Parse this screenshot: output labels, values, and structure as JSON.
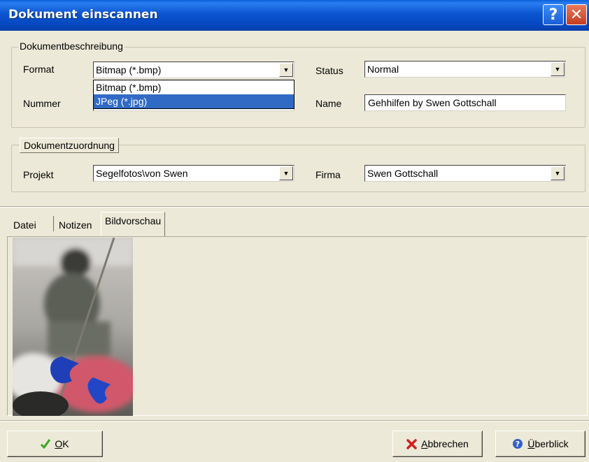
{
  "window": {
    "title": "Dokument einscannen",
    "help_glyph": "?",
    "close_glyph": "✕"
  },
  "beschreibung": {
    "legend": "Dokumentbeschreibung",
    "format_label": "Format",
    "format_value": "Bitmap (*.bmp)",
    "format_options": [
      "Bitmap (*.bmp)",
      "JPeg (*.jpg)"
    ],
    "format_highlighted": "JPeg (*.jpg)",
    "status_label": "Status",
    "status_value": "Normal",
    "nummer_label": "Nummer",
    "nummer_value": "",
    "name_label": "Name",
    "name_value": "Gehhilfen by Swen Gottschall"
  },
  "zuordnung": {
    "legend": "Dokumentzuordnung",
    "projekt_label": "Projekt",
    "projekt_value": "Segelfotos\\von Swen",
    "firma_label": "Firma",
    "firma_value": "Swen Gottschall"
  },
  "tabs": {
    "items": [
      "Datei",
      "Notizen",
      "Bildvorschau"
    ],
    "active": "Bildvorschau"
  },
  "buttons": {
    "ok_access": "O",
    "ok_rest": "K",
    "abbrechen_access": "A",
    "abbrechen_rest": "bbrechen",
    "ueberblick_access": "Ü",
    "ueberblick_rest": "berblick"
  },
  "colors": {
    "title_bar": "#0b55d0",
    "selection": "#316ac5",
    "dialog_bg": "#ece9d8"
  },
  "icons": {
    "ok": "green-checkmark-icon",
    "cancel": "red-x-icon",
    "overview": "blue-question-icon"
  }
}
